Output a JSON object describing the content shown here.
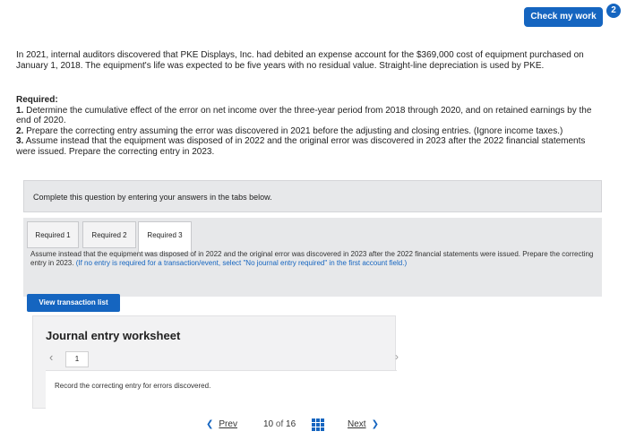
{
  "header": {
    "check_label": "Check my work",
    "badge": "2"
  },
  "problem": {
    "intro": "In 2021, internal auditors discovered that PKE Displays, Inc. had debited an expense account for the $369,000 cost of equipment purchased on January 1, 2018. The equipment's life was expected to be five years with no residual value. Straight-line depreciation is used by PKE.",
    "required_heading": "Required:",
    "items": [
      {
        "num": "1.",
        "text": " Determine the cumulative effect of the error on net income over the three-year period from 2018 through 2020, and on retained earnings by the end of 2020."
      },
      {
        "num": "2.",
        "text": " Prepare the correcting entry assuming the error was discovered in 2021 before the adjusting and closing entries. (Ignore income taxes.)"
      },
      {
        "num": "3.",
        "text": " Assume instead that the equipment was disposed of in 2022 and the original error was discovered in 2023 after the 2022 financial statements were issued. Prepare the correcting entry in 2023."
      }
    ]
  },
  "instruction": "Complete this question by entering your answers in the tabs below.",
  "tabs": [
    {
      "label": "Required 1"
    },
    {
      "label": "Required 2"
    },
    {
      "label": "Required 3"
    }
  ],
  "tab_content": {
    "text": "Assume instead that the equipment was disposed of in 2022 and the original error was discovered in 2023 after the 2022 financial statements were issued. Prepare the correcting entry in 2023. ",
    "note": "(If no entry is required for a transaction/event, select \"No journal entry required\" in the first account field.)"
  },
  "view_button": "View transaction list",
  "worksheet": {
    "title": "Journal entry worksheet",
    "page": "1",
    "record_text": "Record the correcting entry for errors discovered."
  },
  "pager": {
    "prev": "Prev",
    "current": "10",
    "of": "of",
    "total": "16",
    "next": "Next"
  }
}
